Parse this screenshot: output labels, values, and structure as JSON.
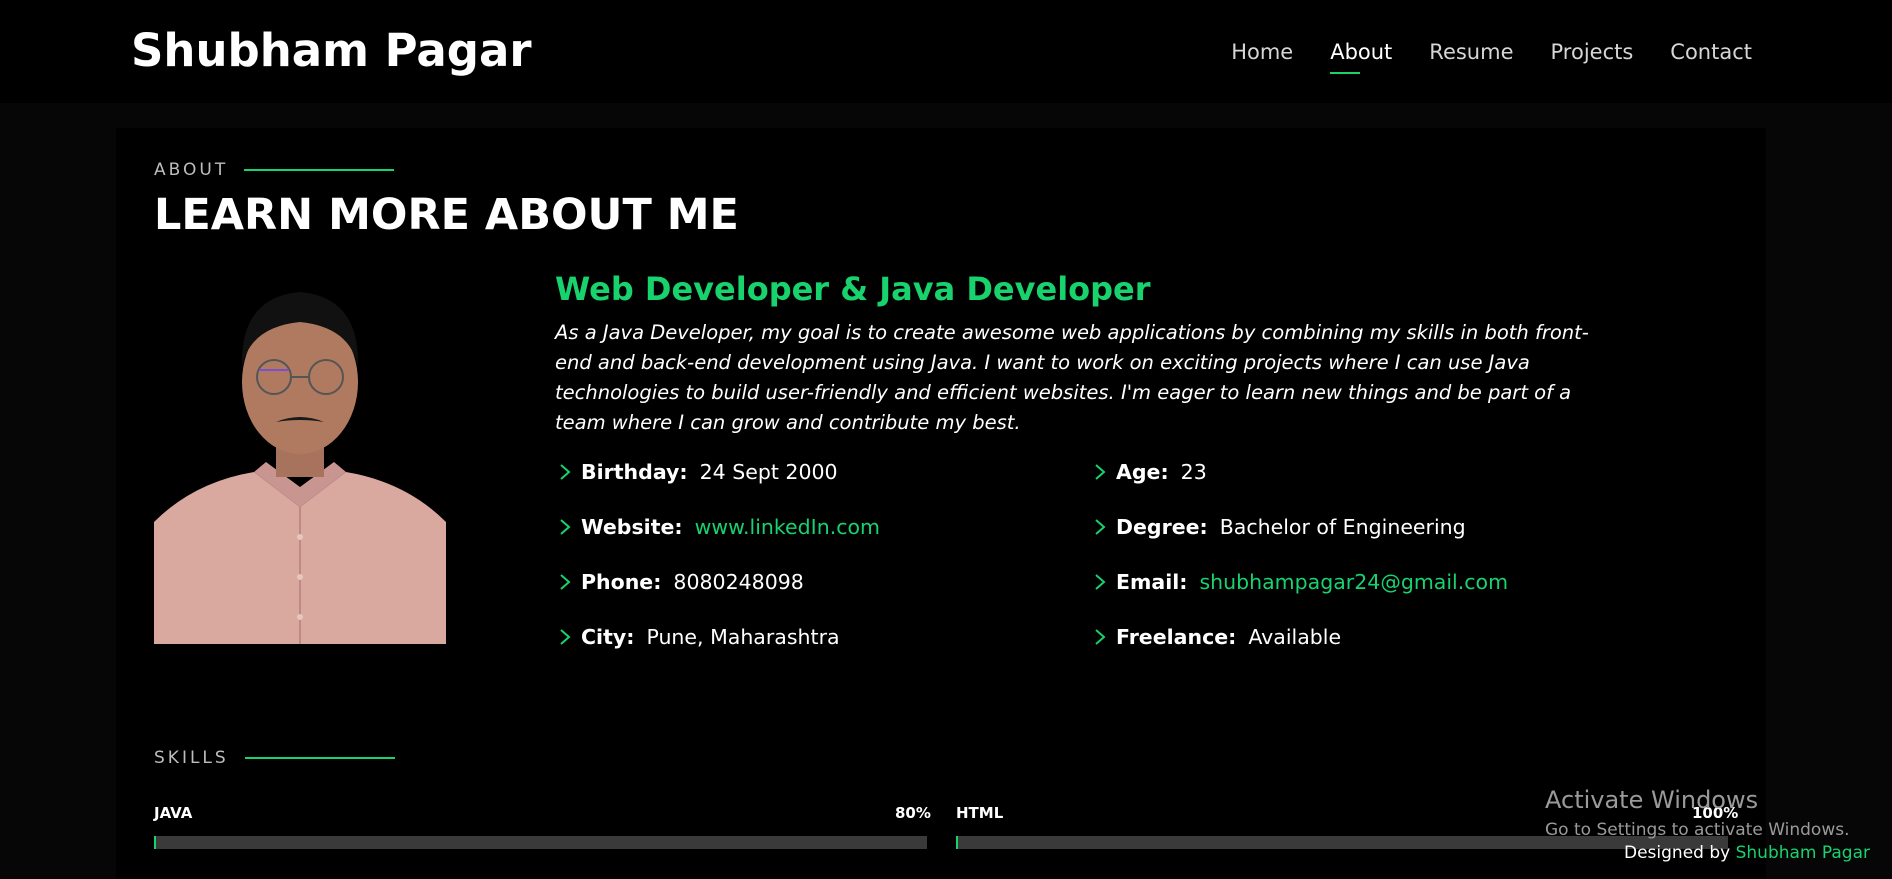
{
  "brand": {
    "name": "Shubham Pagar"
  },
  "nav": {
    "items": [
      {
        "label": "Home",
        "active": false
      },
      {
        "label": "About",
        "active": true
      },
      {
        "label": "Resume",
        "active": false
      },
      {
        "label": "Projects",
        "active": false
      },
      {
        "label": "Contact",
        "active": false
      }
    ]
  },
  "about": {
    "label": "ABOUT",
    "headline": "LEARN MORE ABOUT ME",
    "role": "Web Developer & Java Developer",
    "description": "As a Java Developer, my goal is to create awesome web applications by combining my skills in both front-end and back-end development using Java. I want to work on exciting projects where I can use Java technologies to build user-friendly and efficient websites. I'm eager to learn new things and be part of a team where I can grow and contribute my best.",
    "info_left": [
      {
        "key": "Birthday:",
        "value": "24 Sept 2000",
        "link": false
      },
      {
        "key": "Website:",
        "value": "www.linkedIn.com",
        "link": true
      },
      {
        "key": "Phone:",
        "value": "8080248098",
        "link": false
      },
      {
        "key": "City:",
        "value": "Pune, Maharashtra",
        "link": false
      }
    ],
    "info_right": [
      {
        "key": "Age:",
        "value": "23",
        "link": false
      },
      {
        "key": "Degree:",
        "value": "Bachelor of Engineering",
        "link": false
      },
      {
        "key": "Email:",
        "value": "shubhampagar24@gmail.com",
        "link": true
      },
      {
        "key": "Freelance:",
        "value": "Available",
        "link": false
      }
    ]
  },
  "skills": {
    "label": "SKILLS",
    "items": [
      {
        "name": "JAVA",
        "value_label": "80%",
        "level": 0.8
      },
      {
        "name": "HTML",
        "value_label": "100%",
        "level": 1.0
      }
    ]
  },
  "overlay": {
    "activate_title": "Activate Windows",
    "activate_sub": "Go to Settings to activate Windows."
  },
  "footer": {
    "designed_by": "Designed by",
    "designer": "Shubham Pagar"
  },
  "colors": {
    "accent": "#18d26e",
    "background": "#000000"
  },
  "icons": {
    "info_bullet": "chevron-right-icon"
  }
}
